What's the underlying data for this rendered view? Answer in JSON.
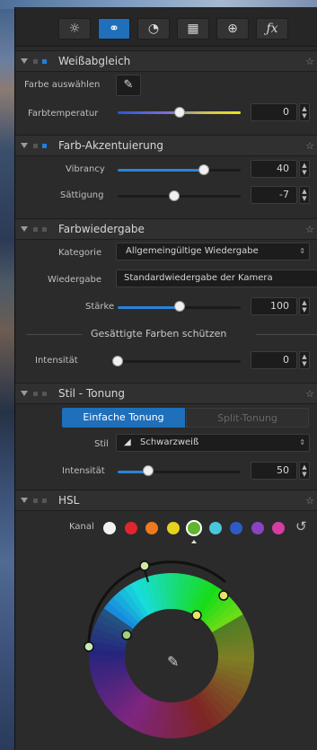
{
  "toolbar": {
    "tabs": [
      {
        "icon": "sun-icon",
        "glyph": "☼"
      },
      {
        "icon": "color-circles-icon",
        "glyph": "⚭"
      },
      {
        "icon": "detail-icon",
        "glyph": "◔"
      },
      {
        "icon": "lens-grid-icon",
        "glyph": "▦"
      },
      {
        "icon": "local-adjust-icon",
        "glyph": "⊕"
      },
      {
        "icon": "effects-fx-icon",
        "glyph": "ƒx"
      }
    ],
    "active": 1
  },
  "white_balance": {
    "title": "Weißabgleich",
    "pick_label": "Farbe auswählen",
    "temp_label": "Farbtemperatur",
    "temp_value": "0",
    "temp_level": 0.5
  },
  "accent": {
    "title": "Farb-Akzentuierung",
    "vibrancy_label": "Vibrancy",
    "vibrancy_value": "40",
    "vibrancy_level": 0.7,
    "saturation_label": "Sättigung",
    "saturation_value": "-7",
    "saturation_level": 0.46
  },
  "rendering": {
    "title": "Farbwiedergabe",
    "category_label": "Kategorie",
    "category_value": "Allgemeingültige Wiedergabe",
    "rendering_label": "Wiedergabe",
    "rendering_value": "Standardwiedergabe der Kamera",
    "strength_label": "Stärke",
    "strength_value": "100",
    "strength_level": 0.5,
    "protect_label": "Gesättigte Farben schützen",
    "intensity_label": "Intensität",
    "intensity_value": "0",
    "intensity_level": 0.0
  },
  "toning": {
    "title": "Stil - Tonung",
    "tab_simple": "Einfache Tonung",
    "tab_split": "Split-Tonung",
    "style_label": "Stil",
    "style_value": "Schwarzweiß",
    "intensity_label": "Intensität",
    "intensity_value": "50",
    "intensity_level": 0.25
  },
  "hsl": {
    "title": "HSL",
    "channel_label": "Kanal",
    "channels": [
      "#f2f2f2",
      "#e0262c",
      "#ee7a1d",
      "#e5d31c",
      "#5fb52d",
      "#48c6dc",
      "#2d5cc4",
      "#8a43c2",
      "#d43ea0"
    ],
    "selected_channel": 4
  },
  "colors": {
    "accent": "#2b83d9",
    "panel": "#2b2b2b"
  }
}
